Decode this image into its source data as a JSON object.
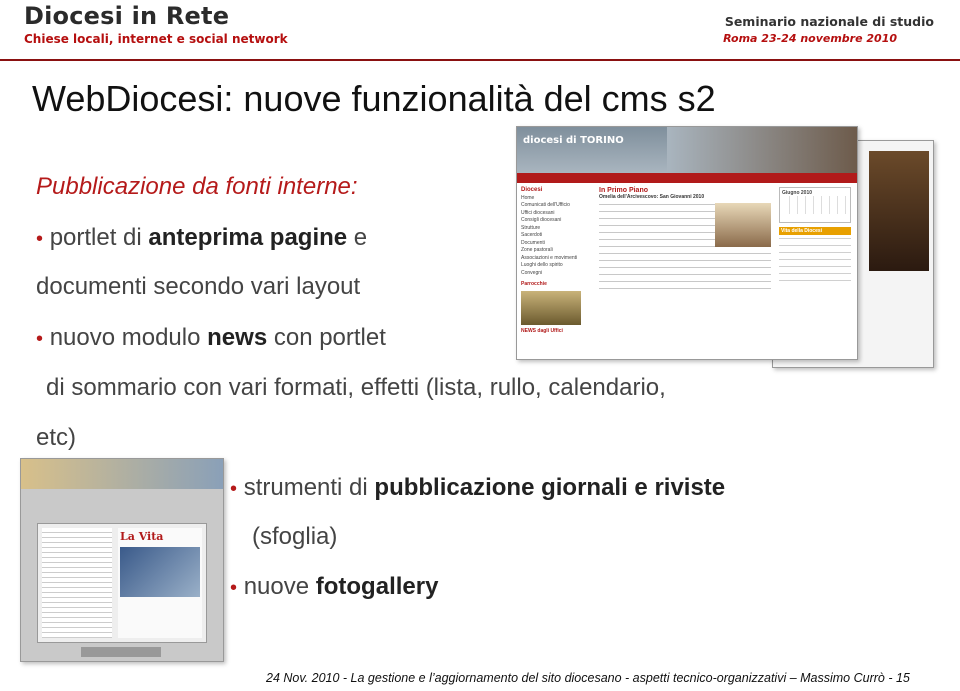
{
  "header": {
    "brand_title": "Diocesi in Rete",
    "brand_subtitle": "Chiese locali, internet e social network",
    "seminar_title": "Seminario nazionale di studio",
    "seminar_subtitle": "Roma 23-24 novembre 2010",
    "accent_color": "#b50f0f"
  },
  "slide": {
    "title": "WebDiocesi: nuove funzionalità del cms s2",
    "subtitle": "Pubblicazione da fonti interne:",
    "bullet1": {
      "a": "portlet di ",
      "b": "anteprima pagine",
      "c": " e"
    },
    "bullet1_cont": "documenti secondo vari layout",
    "bullet2": {
      "a": "nuovo modulo ",
      "b": "news",
      "c": " con portlet"
    },
    "bullet2_cont": "di sommario con vari formati, effetti (lista, rullo, calendario,",
    "bullet2_cont2": "etc)",
    "bullet3": {
      "a": "strumenti di ",
      "b": "pubblicazione giornali e riviste"
    },
    "bullet3_cont": "(sfoglia)",
    "bullet4": {
      "a": "nuove ",
      "b": "fotogallery"
    }
  },
  "screenshot_texts": {
    "site_logo": "diocesi di TORINO",
    "menu_title": "Diocesi",
    "menu_items": [
      "Home",
      "Comunicati dell'Ufficio",
      "Uffici diocesani",
      "Consigli diocesani",
      "Strutture",
      "Sacerdoti",
      "Documenti",
      "Zone pastorali",
      "Associazioni e movimenti",
      "Luoghi dello spirito",
      "Convegni"
    ],
    "section_parrocchie": "Parrocchie",
    "news_heading": "NEWS dagli Uffici",
    "in_primo_piano": "In Primo Piano",
    "article_title": "Omelia dell'Arcivescovo: San Giovanni 2010",
    "calendar_month": "Giugno 2010",
    "vita_diocesi": "Vita della Diocesi",
    "magazine_name": "La Vita"
  },
  "footer": {
    "text": "24 Nov. 2010 - La gestione e l’aggiornamento del sito diocesano - aspetti tecnico-organizzativi – Massimo Currò - 15"
  }
}
